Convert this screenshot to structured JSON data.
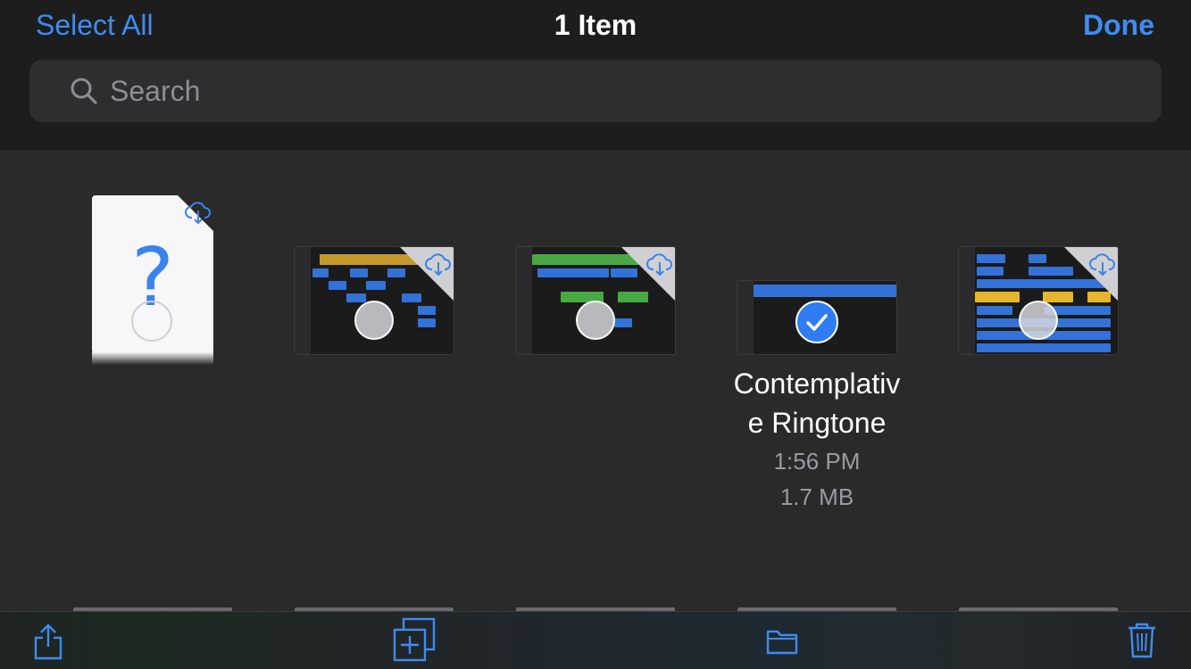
{
  "nav": {
    "select_all": "Select All",
    "title": "1 Item",
    "done": "Done"
  },
  "search": {
    "placeholder": "Search"
  },
  "items": [
    {
      "kind": "unknown-document",
      "icon": "question-mark-icon",
      "selected": false,
      "cloud": true
    },
    {
      "kind": "garageband-project",
      "accent": "#c49a2a",
      "selected": false,
      "cloud": true
    },
    {
      "kind": "garageband-project",
      "accent": "#48a944",
      "selected": false,
      "cloud": true
    },
    {
      "kind": "garageband-project",
      "name": "Contemplative Ringtone",
      "name_line1": "Contemplativ",
      "name_line2": "e Ringtone",
      "time": "1:56 PM",
      "size": "1.7 MB",
      "selected": true,
      "cloud": false
    },
    {
      "kind": "garageband-project",
      "accent": "#e5b62e",
      "selected": false,
      "cloud": true
    }
  ],
  "toolbar": {
    "share": "share-icon",
    "duplicate": "duplicate-icon",
    "move": "folder-icon",
    "delete": "trash-icon"
  },
  "colors": {
    "accent": "#3d8cf0",
    "background": "#2a2a2b",
    "bar": "#1d1d1e"
  }
}
